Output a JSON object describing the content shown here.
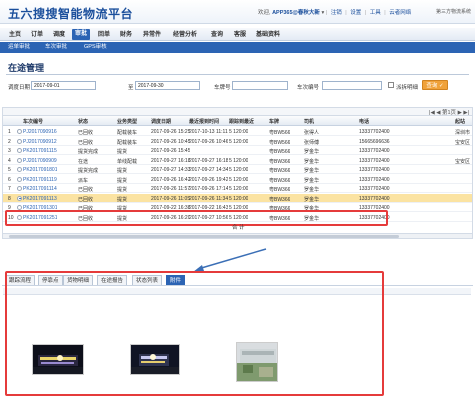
{
  "header": {
    "logo": "五六搜搜智能物流平台",
    "welcome": "欢迎,",
    "brand": "APP365@春秋大新",
    "caret": "▾",
    "links": [
      "注销",
      "设置",
      "工具",
      "云者网络"
    ],
    "system": "第三方物流系统"
  },
  "nav": {
    "items": [
      "主页",
      "订单",
      "调度",
      "审批",
      "回单",
      "财务",
      "异常件",
      "经营分析",
      "查询",
      "客服",
      "基础资料"
    ],
    "active_index": 3
  },
  "subnav": {
    "items": [
      "运单审批",
      "车次审批",
      "GPS审核"
    ]
  },
  "page": {
    "title": "在途管理"
  },
  "filters": {
    "date_label": "调度日期",
    "date_from": "2017-09-01",
    "to_label": "至",
    "date_to": "2017-09-30",
    "vehicle_label": "车牌号",
    "trip_label": "车次编号",
    "check_label": "派拆明细",
    "query_button": "查询 ✓"
  },
  "pager": {
    "text": "|◀  ◀  第1页  ▶  ▶|"
  },
  "table": {
    "columns": [
      "",
      "",
      "车次编号",
      "状态",
      "业务类型",
      "调度日期",
      "最近报到时间",
      "跟踪到最近",
      "车牌",
      "司机",
      "电话",
      "起站"
    ],
    "rows": [
      [
        "1",
        "PJ2017090916",
        "已回收",
        "配载装车",
        "2017-09-26 15:25",
        "2017-10-13 11:11",
        "5 120:00",
        "粤BW566",
        "张得人",
        "13337702400",
        "深圳市"
      ],
      [
        "2",
        "PJ2017090912",
        "已回收",
        "配载装车",
        "2017-09-26 10:45",
        "2017-09-26 10:46",
        "5 120:00",
        "粤BW566",
        "张师傅",
        "15665696636",
        "宝安区"
      ],
      [
        "3",
        "PK2017091115",
        "提货完成",
        "提货",
        "2017-09-26 15:45",
        "",
        "",
        "粤BW566",
        "罗金华",
        "13337702400",
        ""
      ],
      [
        "4",
        "PJ2017090909",
        "在途",
        "单线配载",
        "2017-09-27 16:18",
        "2017-09-27 16:18",
        "5 120:00",
        "粤BW366",
        "罗金华",
        "13337702400",
        "宝安区"
      ],
      [
        "5",
        "PK2017091801",
        "提货完成",
        "提货",
        "2017-09-27 14:33",
        "2017-09-27 14:34",
        "5 120:00",
        "粤BW366",
        "罗金华",
        "13337702400",
        ""
      ],
      [
        "6",
        "PK2017091119",
        "派车",
        "提货",
        "2017-09-26 16:42",
        "2017-09-26 19:42",
        "5 120:00",
        "粤BW366",
        "罗金华",
        "13337702400",
        ""
      ],
      [
        "7",
        "PK2017091114",
        "已回收",
        "提货",
        "2017-09-26 11:57",
        "2017-09-26 17:14",
        "5 120:00",
        "粤BW366",
        "罗金华",
        "13337702400",
        ""
      ],
      [
        "8",
        "PK2017091113",
        "已回收",
        "提货",
        "2017-09-26 11:05",
        "2017-09-26 11:34",
        "5 120:00",
        "粤BW366",
        "罗金华",
        "13337702400",
        ""
      ],
      [
        "9",
        "PK2017091301",
        "已回收",
        "提货",
        "2017-09-22 16:38",
        "2017-09-22 16:43",
        "5 120:00",
        "粤BW366",
        "罗金华",
        "13337702400",
        ""
      ],
      [
        "10",
        "PK2017091251",
        "已回收",
        "提货",
        "2017-09-26 16:20",
        "2017-09-27 10:56",
        "5 120:00",
        "粤BW366",
        "罗金华",
        "13337702400",
        ""
      ]
    ],
    "selected_index": 7,
    "summary_label": "合   计"
  },
  "tabs": {
    "items": [
      "跟踪流程",
      "停靠点",
      "货物明细",
      "在途报告",
      "状态列表",
      "附件"
    ],
    "active_index": 5
  },
  "photos": [
    "night-building-photo",
    "night-building-photo",
    "construction-site-photo"
  ],
  "colors": {
    "primary": "#2c64b4",
    "highlight": "#fbe3a2",
    "annotation": "#e53b3b",
    "query": "#f0a23a"
  }
}
